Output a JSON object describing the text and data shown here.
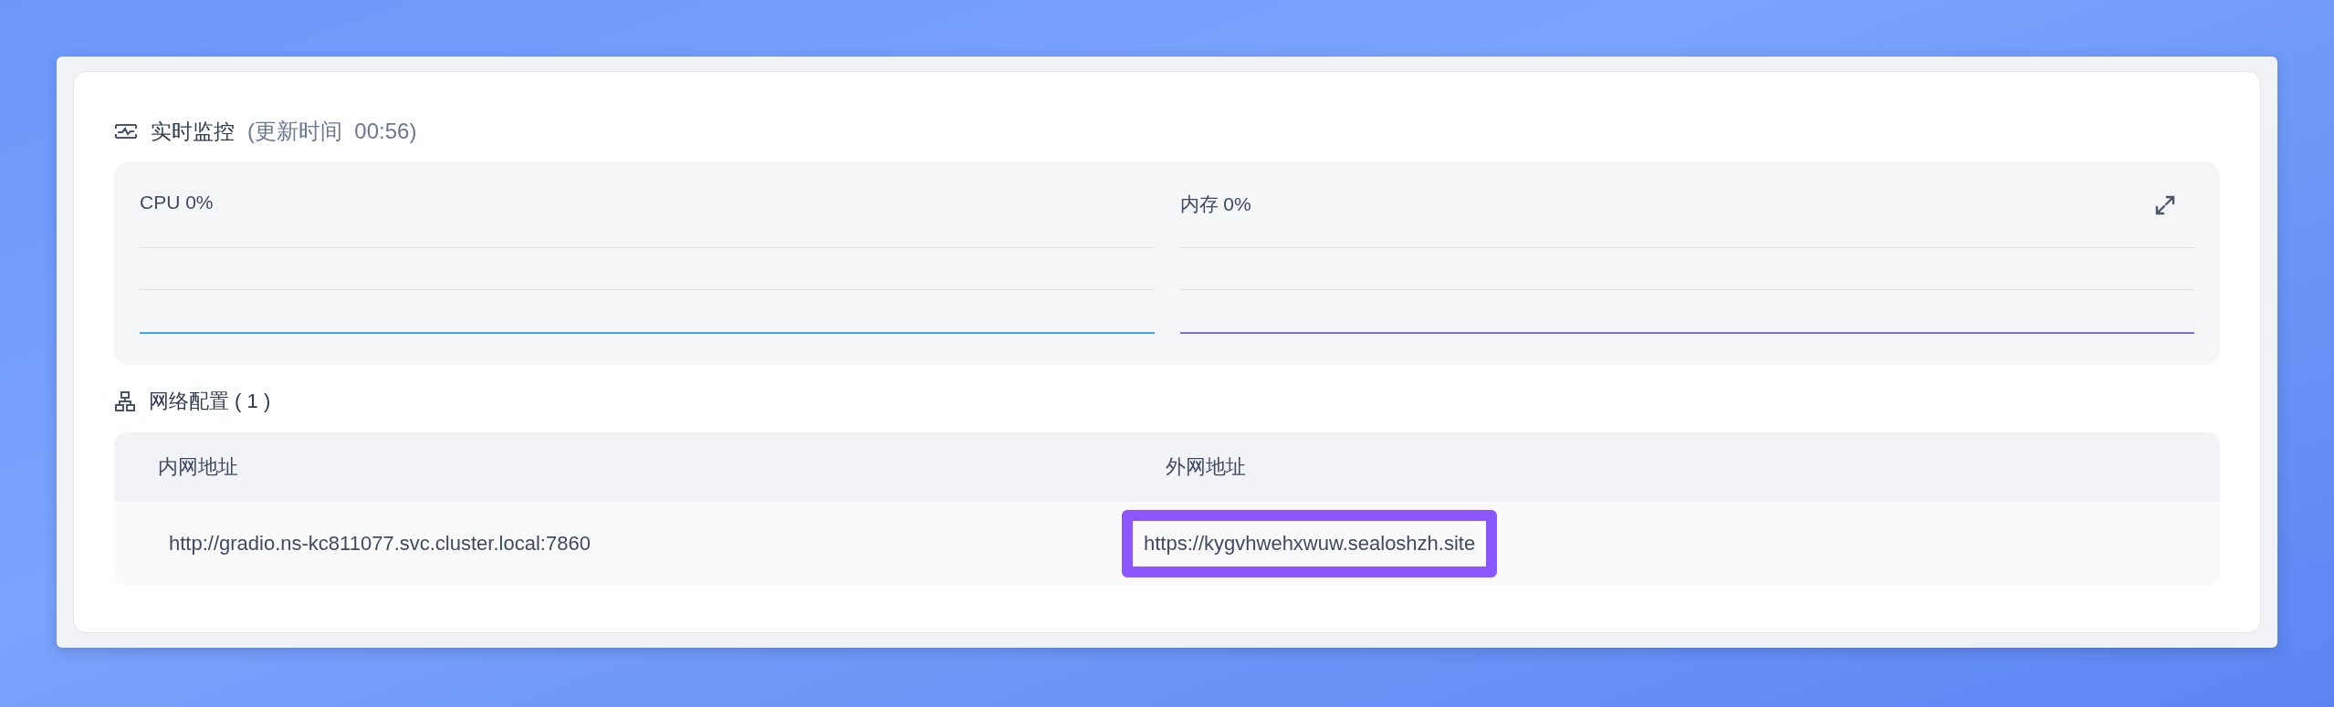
{
  "monitor": {
    "title": "实时监控",
    "updated": "(更新时间  00:56)",
    "charts": [
      {
        "label": "CPU 0%",
        "color": "#3ea6f2"
      },
      {
        "label": "内存 0%",
        "color": "#7b6fe0"
      }
    ]
  },
  "network": {
    "title": "网络配置 ( 1 )",
    "columns": [
      "内网地址",
      "外网地址"
    ],
    "rows": [
      [
        {
          "text": "http://gradio.ns-kc811077.svc.cluster.local:7860",
          "highlighted": false
        },
        {
          "text": "https://kygvhwehxwuw.sealoshzh.site",
          "highlighted": true
        }
      ]
    ]
  }
}
